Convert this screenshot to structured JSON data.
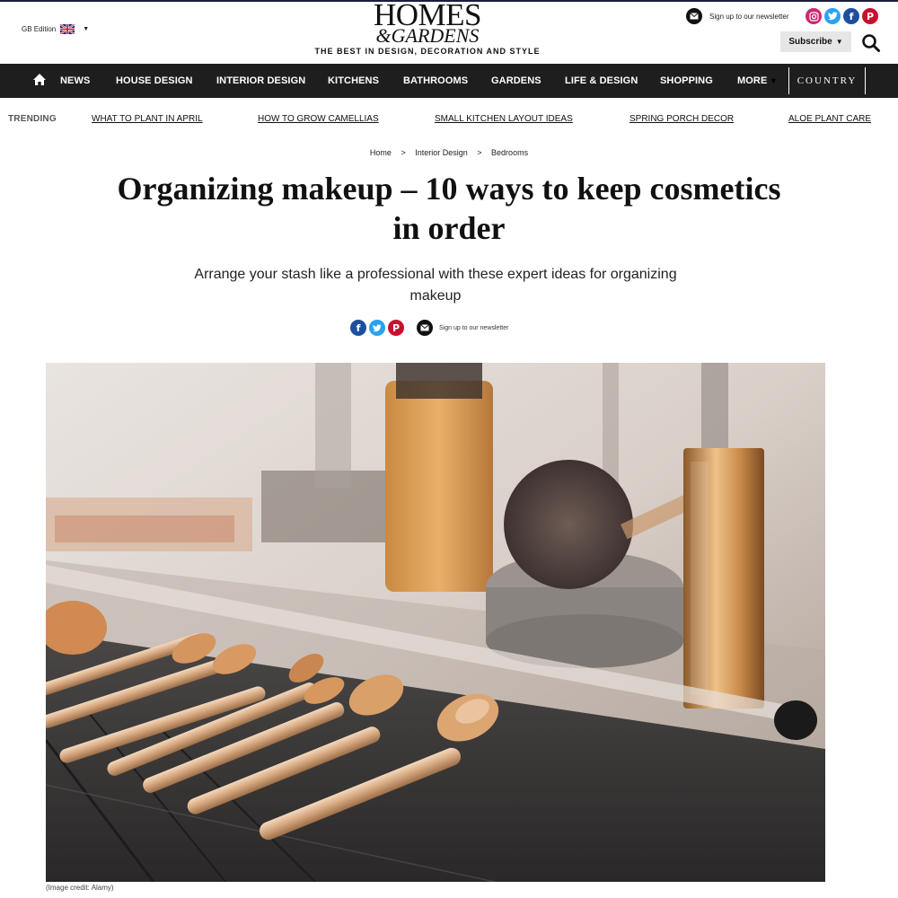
{
  "header": {
    "edition_label": "GB Edition",
    "logo_main": "HOMES",
    "logo_sub": "&GARDENS",
    "tagline": "THE BEST IN DESIGN, DECORATION AND STYLE",
    "newsletter_label": "Sign up to our newsletter",
    "subscribe_label": "Subscribe",
    "social_icons": [
      "instagram-icon",
      "twitter-icon",
      "facebook-icon",
      "pinterest-icon"
    ]
  },
  "nav": {
    "items": [
      "NEWS",
      "HOUSE DESIGN",
      "INTERIOR DESIGN",
      "KITCHENS",
      "BATHROOMS",
      "GARDENS",
      "LIFE & DESIGN",
      "SHOPPING",
      "MORE"
    ],
    "country_label": "COUNTRY"
  },
  "trending": {
    "label": "TRENDING",
    "links": [
      "WHAT TO PLANT IN APRIL",
      "HOW TO GROW CAMELLIAS",
      "SMALL KITCHEN LAYOUT IDEAS",
      "SPRING PORCH DECOR",
      "ALOE PLANT CARE"
    ]
  },
  "breadcrumb": [
    "Home",
    "Interior Design",
    "Bedrooms"
  ],
  "breadcrumb_separator": ">",
  "article": {
    "title": "Organizing makeup – 10 ways to keep cosmetics in order",
    "subtitle": "Arrange your stash like a professional with these expert ideas for organizing makeup",
    "share_newsletter_label": "Sign up to our newsletter",
    "image_credit": "(Image credit: Alamy)"
  },
  "colors": {
    "nav_bg": "#1e1e1e",
    "instagram": "#d6246e",
    "twitter": "#2aa3ef",
    "facebook": "#1e4f9c",
    "pinterest": "#c8102e"
  }
}
